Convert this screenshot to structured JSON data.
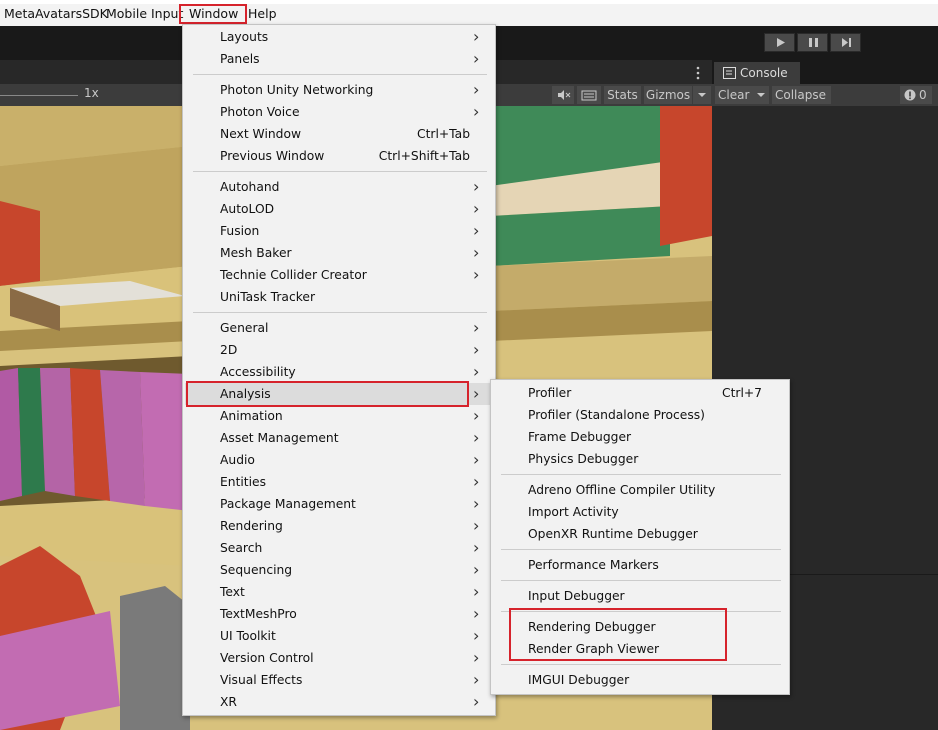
{
  "menubar": {
    "items": [
      "MetaAvatarsSDK",
      "Mobile Input",
      "Window",
      "Help"
    ]
  },
  "toolbar": {
    "play_icon": "play-icon",
    "pause_icon": "pause-icon",
    "step_icon": "step-icon",
    "more_icon": "more-vert-icon"
  },
  "sceneview": {
    "zoom_label": "1x",
    "stats_label": "Stats",
    "gizmos_label": "Gizmos"
  },
  "console": {
    "tab_label": "Console",
    "clear_label": "Clear",
    "collapse_label": "Collapse",
    "error_count": "0"
  },
  "window_menu": {
    "groups": [
      [
        {
          "label": "Layouts",
          "submenu": true
        },
        {
          "label": "Panels",
          "submenu": true
        }
      ],
      [
        {
          "label": "Photon Unity Networking",
          "submenu": true
        },
        {
          "label": "Photon Voice",
          "submenu": true
        },
        {
          "label": "Next Window",
          "shortcut": "Ctrl+Tab"
        },
        {
          "label": "Previous Window",
          "shortcut": "Ctrl+Shift+Tab"
        }
      ],
      [
        {
          "label": "Autohand",
          "submenu": true
        },
        {
          "label": "AutoLOD",
          "submenu": true
        },
        {
          "label": "Fusion",
          "submenu": true
        },
        {
          "label": "Mesh Baker",
          "submenu": true
        },
        {
          "label": "Technie Collider Creator",
          "submenu": true
        },
        {
          "label": "UniTask Tracker"
        }
      ],
      [
        {
          "label": "General",
          "submenu": true
        },
        {
          "label": "2D",
          "submenu": true
        },
        {
          "label": "Accessibility",
          "submenu": true
        },
        {
          "label": "Analysis",
          "submenu": true,
          "selected": true
        },
        {
          "label": "Animation",
          "submenu": true
        },
        {
          "label": "Asset Management",
          "submenu": true
        },
        {
          "label": "Audio",
          "submenu": true
        },
        {
          "label": "Entities",
          "submenu": true
        },
        {
          "label": "Package Management",
          "submenu": true
        },
        {
          "label": "Rendering",
          "submenu": true
        },
        {
          "label": "Search",
          "submenu": true
        },
        {
          "label": "Sequencing",
          "submenu": true
        },
        {
          "label": "Text",
          "submenu": true
        },
        {
          "label": "TextMeshPro",
          "submenu": true
        },
        {
          "label": "UI Toolkit",
          "submenu": true
        },
        {
          "label": "Version Control",
          "submenu": true
        },
        {
          "label": "Visual Effects",
          "submenu": true
        },
        {
          "label": "XR",
          "submenu": true
        }
      ]
    ]
  },
  "analysis_menu": {
    "groups": [
      [
        {
          "label": "Profiler",
          "shortcut": "Ctrl+7"
        },
        {
          "label": "Profiler (Standalone Process)"
        },
        {
          "label": "Frame Debugger"
        },
        {
          "label": "Physics Debugger"
        }
      ],
      [
        {
          "label": "Adreno Offline Compiler Utility"
        },
        {
          "label": "Import Activity"
        },
        {
          "label": "OpenXR Runtime Debugger"
        }
      ],
      [
        {
          "label": "Performance Markers"
        }
      ],
      [
        {
          "label": "Input Debugger"
        }
      ],
      [
        {
          "label": "Rendering Debugger"
        },
        {
          "label": "Render Graph Viewer"
        }
      ],
      [
        {
          "label": "IMGUI Debugger"
        }
      ]
    ]
  },
  "colors": {
    "highlight": "#d6232c",
    "menu_bg": "#f2f2f2",
    "editor_dark": "#282828"
  }
}
